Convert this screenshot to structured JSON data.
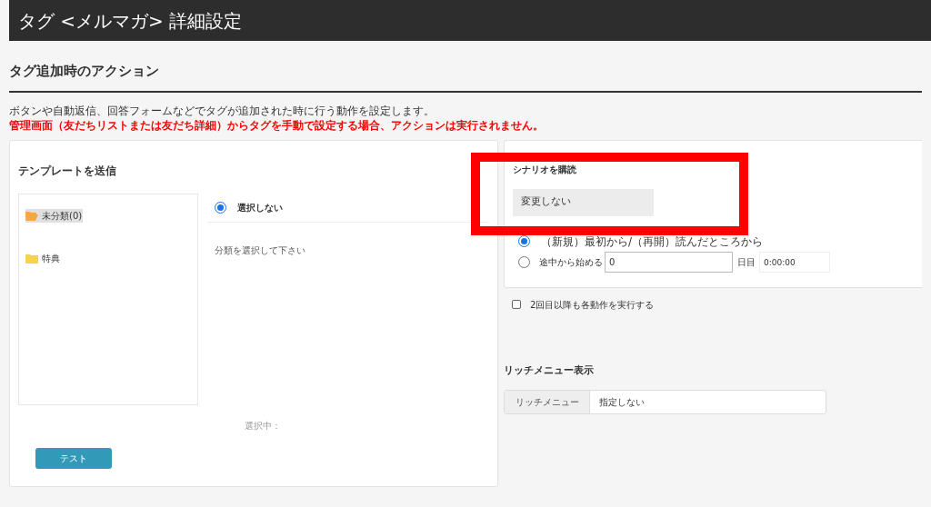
{
  "header": {
    "title": "タグ <メルマガ> 詳細設定"
  },
  "section": {
    "title": "タグ追加時のアクション",
    "description": "ボタンや自動返信、回答フォームなどでタグが追加された時に行う動作を設定します。",
    "warning": "管理画面（友だちリストまたは友だち詳細）からタグを手動で設定する場合、アクションは実行されません。"
  },
  "template": {
    "title": "テンプレートを送信",
    "folders": [
      {
        "label": "未分類(0)",
        "selected": true
      },
      {
        "label": "特典",
        "selected": false
      }
    ],
    "none_option": {
      "label": "選択しない",
      "selected": true
    },
    "hint": "分類を選択して下さい",
    "selected_label": "選択中：",
    "test_button": "テスト"
  },
  "scenario": {
    "title": "シナリオを購読",
    "select_value": "変更しない",
    "options": [
      {
        "kind": "plain",
        "label": "（新規）最初から/（再開）読んだところから",
        "selected": true
      },
      {
        "kind": "offset",
        "label": "途中から始める",
        "selected": false,
        "day_value": "0",
        "day_unit": "日目",
        "time_value": "0:00:00"
      }
    ]
  },
  "repeat": {
    "label": "2回目以降も各動作を実行する",
    "checked": false
  },
  "rich_menu": {
    "title": "リッチメニュー表示",
    "addon": "リッチメニュー",
    "value": "指定しない"
  }
}
